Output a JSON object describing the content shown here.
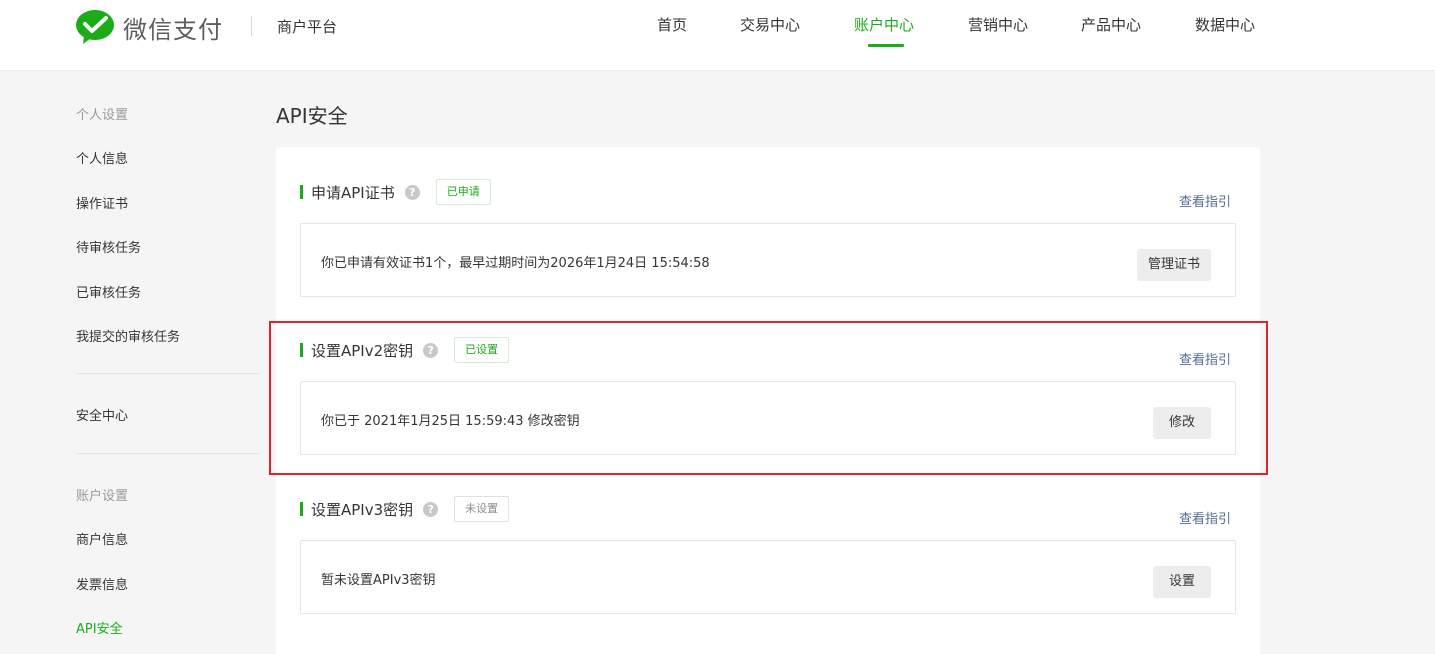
{
  "header": {
    "logo_text": "微信支付",
    "platform": "商户平台",
    "nav": [
      {
        "label": "首页"
      },
      {
        "label": "交易中心"
      },
      {
        "label": "账户中心"
      },
      {
        "label": "营销中心"
      },
      {
        "label": "产品中心"
      },
      {
        "label": "数据中心"
      }
    ],
    "active_nav": "账户中心"
  },
  "sidebar": {
    "group_personal": "个人设置",
    "personal_items": [
      "个人信息",
      "操作证书",
      "待审核任务",
      "已审核任务",
      "我提交的审核任务"
    ],
    "security_center": "安全中心",
    "group_account": "账户设置",
    "account_items": [
      "商户信息",
      "发票信息",
      "API安全"
    ],
    "active_item": "API安全"
  },
  "main": {
    "title": "API安全",
    "sections": [
      {
        "title": "申请API证书",
        "badge": "已申请",
        "guide": "查看指引",
        "info": "你已申请有效证书1个，最早过期时间为2026年1月24日 15:54:58",
        "button": "管理证书"
      },
      {
        "title": "设置APIv2密钥",
        "badge": "已设置",
        "guide": "查看指引",
        "info": "你已于 2021年1月25日 15:59:43 修改密钥",
        "button": "修改"
      },
      {
        "title": "设置APIv3密钥",
        "badge": "未设置",
        "guide": "查看指引",
        "info": "暂未设置APIv3密钥",
        "button": "设置"
      }
    ]
  },
  "colors": {
    "brand_green": "#1aad19",
    "link_blue": "#576b95",
    "highlight_red": "#d9262e"
  },
  "icons": {
    "logo": "wechat-pay-logo-icon",
    "help": "question-circle-icon"
  }
}
